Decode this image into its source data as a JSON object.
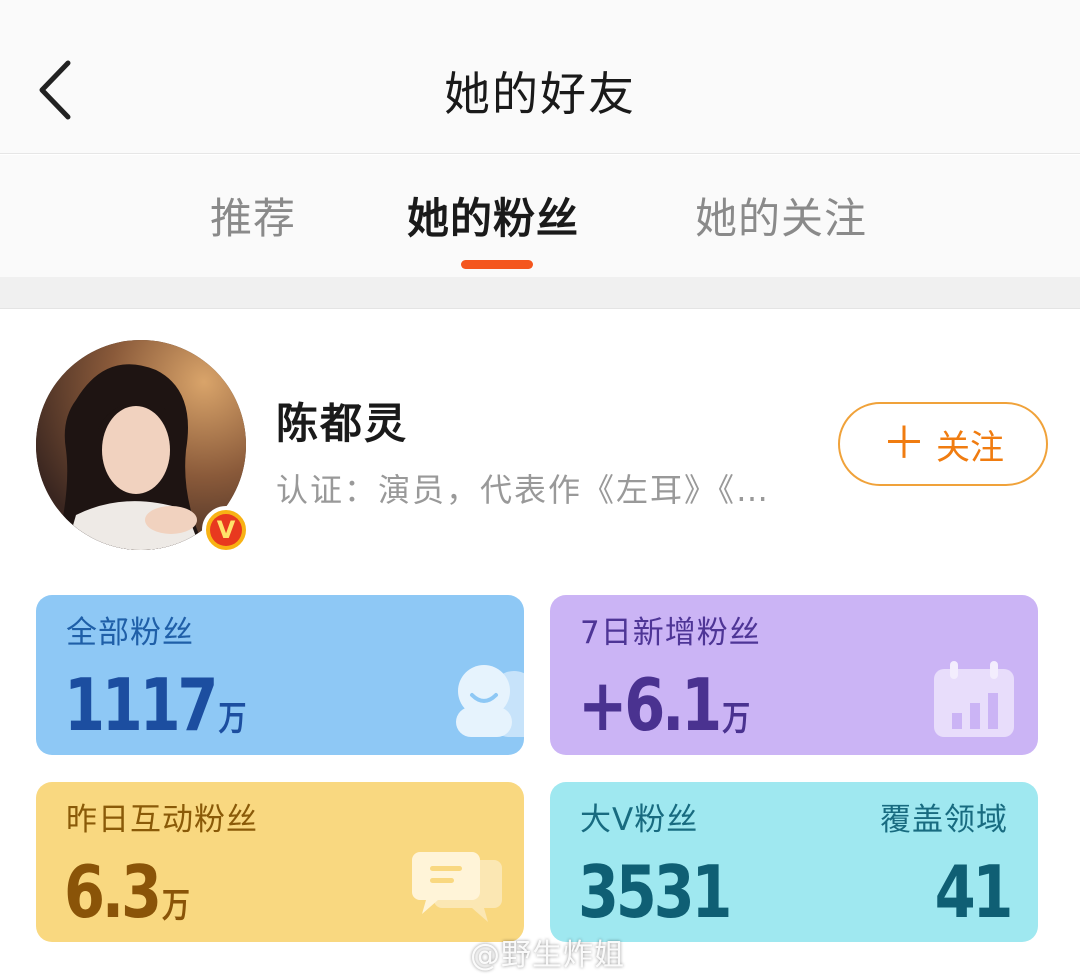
{
  "header": {
    "title": "她的好友",
    "back_icon": "back-arrow-icon"
  },
  "tabs": [
    {
      "label": "推荐",
      "active": false
    },
    {
      "label": "她的粉丝",
      "active": true
    },
    {
      "label": "她的关注",
      "active": false
    }
  ],
  "accent_color": "#f4561e",
  "profile": {
    "name": "陈都灵",
    "certification": "认证：演员，代表作《左耳》《…",
    "badge": "V",
    "follow_button": {
      "plus": "＋",
      "label": "关注"
    }
  },
  "stats": {
    "all_fans": {
      "label": "全部粉丝",
      "value": "1117",
      "unit": "万",
      "icon": "fans-group-icon"
    },
    "new_fans_7d": {
      "label": "7日新增粉丝",
      "value": "+6.1",
      "unit": "万",
      "icon": "calendar-chart-icon"
    },
    "active_fans_yesterday": {
      "label": "昨日互动粉丝",
      "value": "6.3",
      "unit": "万",
      "icon": "chat-bubble-icon"
    },
    "big_v_fans": {
      "label": "大V粉丝",
      "value": "3531",
      "coverage_label": "覆盖领域",
      "coverage_value": "41"
    }
  },
  "watermark": "@野生炸姐"
}
